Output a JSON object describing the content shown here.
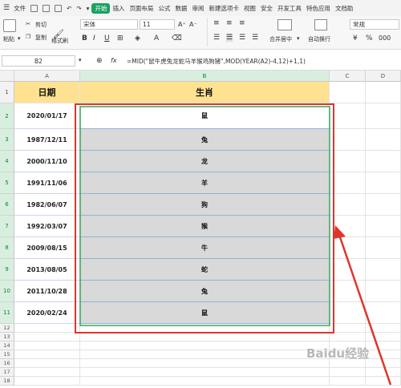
{
  "menubar": {
    "file": "文件",
    "tabs": [
      "开始",
      "插入",
      "页面布局",
      "公式",
      "数据",
      "审阅",
      "新建选项卡",
      "视图",
      "安全",
      "开发工具",
      "特色应用",
      "文档助"
    ]
  },
  "ribbon": {
    "cut": "剪切",
    "paste": "粘贴",
    "copy": "复制",
    "format_painter": "格式刷",
    "font_name": "宋体",
    "font_size": "11",
    "merge_center": "合并居中",
    "wrap_text": "自动换行",
    "number_format": "常规",
    "bold": "B",
    "italic": "I",
    "underline": "U"
  },
  "formula_bar": {
    "name_box": "B2",
    "fx": "fx",
    "formula": "=MID(\"鼠牛虎兔龙蛇马羊猴鸡狗猪\",MOD(YEAR(A2)-4,12)+1,1)"
  },
  "sheet": {
    "columns": [
      "A",
      "B",
      "C",
      "D"
    ],
    "rows": [
      "1",
      "2",
      "3",
      "4",
      "5",
      "6",
      "7",
      "8",
      "9",
      "10",
      "11",
      "12",
      "13",
      "14",
      "15",
      "16",
      "17",
      "18"
    ],
    "header_a": "日期",
    "header_b": "生肖",
    "dates": [
      "2020/01/17",
      "1987/12/11",
      "2000/11/10",
      "1991/11/06",
      "1982/06/07",
      "1992/03/07",
      "2009/08/15",
      "2013/08/05",
      "2011/10/28",
      "2020/02/24"
    ],
    "zodiac": [
      "鼠",
      "兔",
      "龙",
      "羊",
      "狗",
      "猴",
      "牛",
      "蛇",
      "兔",
      "鼠"
    ]
  },
  "colors": {
    "header_fill": "#ffe291",
    "selection_fill": "#d9d9d9",
    "annotation_red": "#e0342b",
    "accent_green": "#1aa260"
  },
  "watermark": "Baidu经验"
}
